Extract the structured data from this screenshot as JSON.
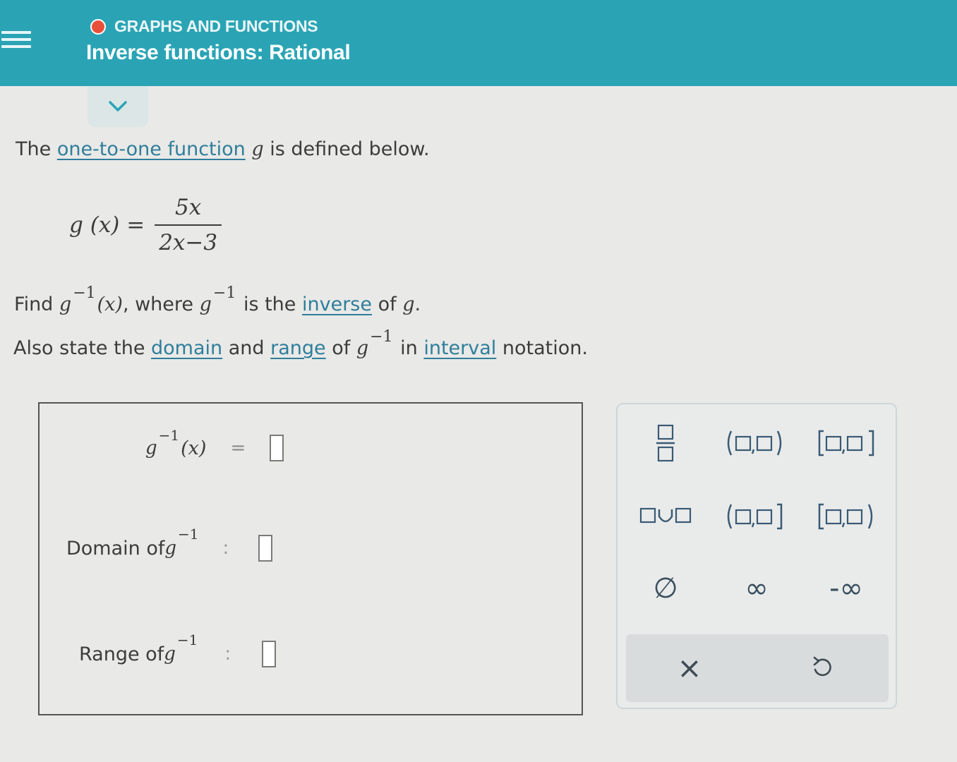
{
  "header": {
    "topic": "GRAPHS AND FUNCTIONS",
    "title": "Inverse functions: Rational",
    "colors": {
      "bar": "#2aa4b5",
      "dot": "#e8503a"
    },
    "icons": [
      "menu-icon",
      "chevron-down-icon"
    ]
  },
  "problem": {
    "intro": {
      "pre": "The ",
      "link": "one-to-one function",
      "var": "g",
      "post": " is defined below."
    },
    "formula": {
      "lhs": "g (x) =",
      "numerator": "5x",
      "denominator": "2x−3"
    },
    "find": {
      "pre": "Find ",
      "g": "g",
      "sup": "−1",
      "arg": "(x)",
      "mid": ", where ",
      "g2": "g",
      "sup2": "−1",
      "text": " is the ",
      "link": "inverse",
      "of": " of ",
      "g3": "g",
      "dot": "."
    },
    "also": {
      "pre": "Also state the ",
      "domain": "domain",
      "and": " and ",
      "range": "range",
      "of": " of ",
      "g": "g",
      "sup": "−1",
      "in": " in ",
      "interval": "interval",
      "post": " notation."
    }
  },
  "answer": {
    "inverse_row": {
      "g": "g",
      "sup": "−1",
      "arg": "(x)",
      "eq": "="
    },
    "domain_row": {
      "label": "Domain of ",
      "g": "g",
      "sup": "−1",
      "colon": ":"
    },
    "range_row": {
      "label": "Range of ",
      "g": "g",
      "sup": "−1",
      "colon": ":"
    }
  },
  "keypad": {
    "keys": [
      "fraction",
      "open-open-interval",
      "closed-closed-interval",
      "union",
      "open-closed-interval",
      "closed-open-interval",
      "empty-set",
      "infinity",
      "negative-infinity",
      "clear",
      "undo"
    ],
    "infinity": "∞",
    "neg_infinity": "-∞",
    "empty_set": "∅",
    "clear": "×"
  }
}
